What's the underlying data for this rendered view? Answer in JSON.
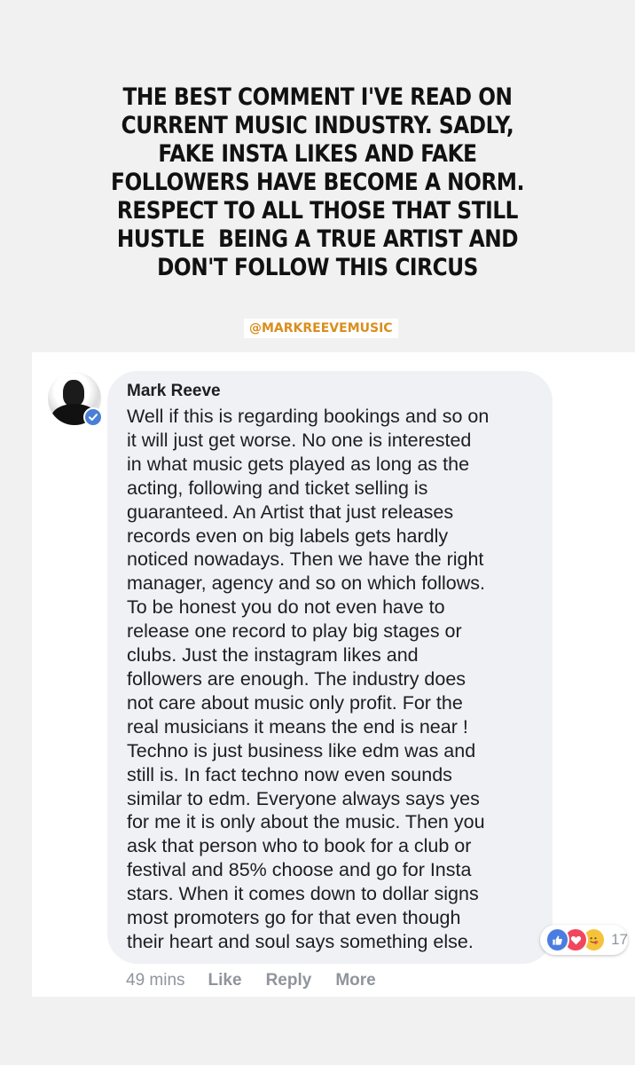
{
  "headline": {
    "lines": [
      "THE BEST COMMENT I'VE READ ON",
      "CURRENT MUSIC INDUSTRY. SADLY,",
      "FAKE INSTA LIKES AND FAKE",
      "FOLLOWERS HAVE BECOME A NORM.",
      "RESPECT TO ALL THOSE THAT STILL",
      "HUSTLE  BEING A TRUE ARTIST AND",
      "DON'T FOLLOW THIS CIRCUS"
    ]
  },
  "mention": "@MARKREEVEMUSIC",
  "comment": {
    "author": "Mark Reeve",
    "lines": [
      "Well if this is regarding bookings and so on",
      "it will just get worse. No one is interested",
      "in what music gets played as long as the",
      "acting, following and ticket selling is",
      "guaranteed. An Artist that just releases",
      "records even on big labels gets hardly",
      "noticed nowadays. Then we have the right",
      "manager, agency and so on which follows.",
      "To be honest you do not even have to",
      "release one record to play big stages or",
      "clubs. Just the instagram likes and",
      "followers are enough. The industry does",
      "not care about music only profit. For the",
      "real musicians it means the end is near !",
      "Techno is just business like edm was and",
      "still is. In fact techno now even sounds",
      "similar to edm. Everyone always says yes",
      "for me it is only about the music. Then you",
      "ask that person who to book for a club or",
      "festival and 85% choose and go for Insta",
      "stars. When it comes down to dollar signs",
      "most promoters go for that even though",
      "their heart and soul says something else."
    ],
    "reactions": {
      "icons": [
        "like-icon",
        "love-icon",
        "care-icon"
      ],
      "count": "17"
    },
    "actions": {
      "time": "49 mins",
      "like": "Like",
      "reply": "Reply",
      "more": "More"
    }
  },
  "colors": {
    "page_background": "#f1f1f1",
    "bubble": "#eff1f4",
    "mention_text": "#d98e1e",
    "verified": "#4a7fd6",
    "meta_text": "#90949c"
  }
}
